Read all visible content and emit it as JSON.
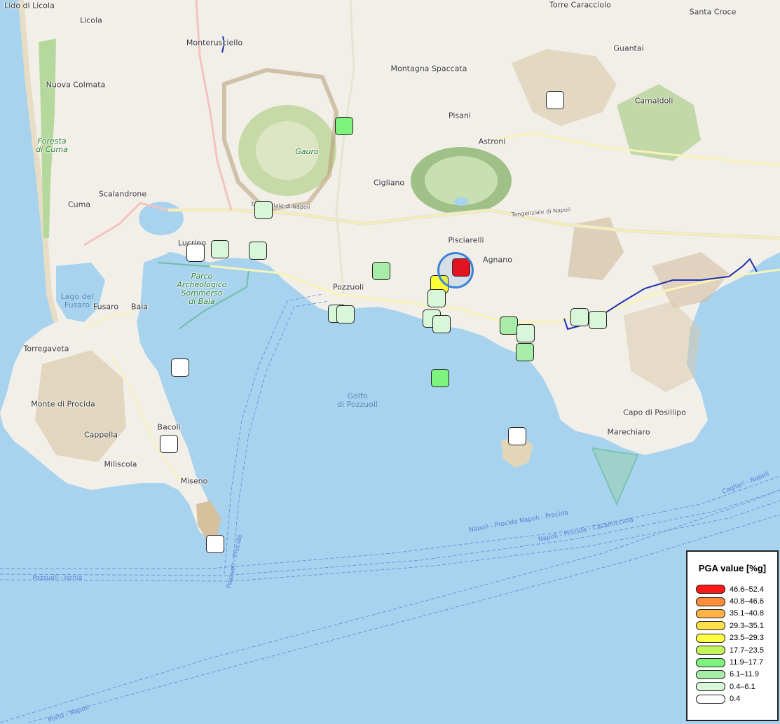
{
  "map": {
    "places": [
      {
        "id": "lido-di-licola",
        "text": "Lido di Licola",
        "type": "town"
      },
      {
        "id": "licola",
        "text": "Licola",
        "type": "town"
      },
      {
        "id": "monterusciello",
        "text": "Monterusciello",
        "type": "town"
      },
      {
        "id": "torre-caracciolo",
        "text": "Torre Caracciolo",
        "type": "town"
      },
      {
        "id": "santa-croce",
        "text": "Santa Croce",
        "type": "town"
      },
      {
        "id": "guantai",
        "text": "Guantai",
        "type": "town"
      },
      {
        "id": "nuova-colmata",
        "text": "Nuova Colmata",
        "type": "town"
      },
      {
        "id": "montagna-spaccata",
        "text": "Montagna\nSpaccata",
        "type": "town"
      },
      {
        "id": "pisani",
        "text": "Pisani",
        "type": "town"
      },
      {
        "id": "camaldoli",
        "text": "Camaldoli",
        "type": "town"
      },
      {
        "id": "astroni",
        "text": "Astroni",
        "type": "town"
      },
      {
        "id": "foresta-di-cuma",
        "text": "Foresta\ndi Cuma",
        "type": "park"
      },
      {
        "id": "gauro",
        "text": "Gauro",
        "type": "park"
      },
      {
        "id": "cigliano",
        "text": "Cigliano",
        "type": "town"
      },
      {
        "id": "scalandrone",
        "text": "Scalandrone",
        "type": "town"
      },
      {
        "id": "cuma",
        "text": "Cuma",
        "type": "town"
      },
      {
        "id": "tangenziale-napoli-1",
        "text": "Tangenziale di Napoli",
        "type": "road"
      },
      {
        "id": "tangenziale-napoli-2",
        "text": "Tangenziale di Napoli",
        "type": "road"
      },
      {
        "id": "pisciarelli",
        "text": "Pisciarelli",
        "type": "town"
      },
      {
        "id": "agnano",
        "text": "Agnano",
        "type": "town"
      },
      {
        "id": "lucrino",
        "text": "Lucrino",
        "type": "town"
      },
      {
        "id": "pozzuoli",
        "text": "Pozzuoli",
        "type": "town"
      },
      {
        "id": "lago-del-fusaro",
        "text": "Lago del\nFusaro",
        "type": "water"
      },
      {
        "id": "fusaro",
        "text": "Fusaro",
        "type": "town"
      },
      {
        "id": "baia",
        "text": "Baia",
        "type": "town"
      },
      {
        "id": "parco-archeologico",
        "text": "Parco\nArcheologico\nSommerso\ndi Baia",
        "type": "park"
      },
      {
        "id": "torregaveta",
        "text": "Torregaveta",
        "type": "town"
      },
      {
        "id": "golfo-di-pozzuoli",
        "text": "Golfo\ndi Pozzuoli",
        "type": "water"
      },
      {
        "id": "monte-di-procida",
        "text": "Monte di Procida",
        "type": "town"
      },
      {
        "id": "bacoli",
        "text": "Bacoli",
        "type": "town"
      },
      {
        "id": "cappella",
        "text": "Cappella",
        "type": "town"
      },
      {
        "id": "miliscola",
        "text": "Miliscola",
        "type": "town"
      },
      {
        "id": "miseno",
        "text": "Miseno",
        "type": "town"
      },
      {
        "id": "capo-di-posillipo",
        "text": "Capo di Posillipo",
        "type": "town"
      },
      {
        "id": "marechiaro",
        "text": "Marechiaro",
        "type": "town"
      },
      {
        "id": "napoli-procida-1",
        "text": "Napoli - Procida  Napoli - Procida",
        "type": "ferry"
      },
      {
        "id": "napoli-procida-2",
        "text": "Napoli - Procida - Casamicciola",
        "type": "ferry"
      },
      {
        "id": "pozzuoli-ischia",
        "text": "Pozzuoli - Ischia",
        "type": "ferry"
      },
      {
        "id": "pozzuoli-procida",
        "text": "Pozzuoli - Procida",
        "type": "ferry"
      },
      {
        "id": "cagliari-napoli",
        "text": "Cagliari - Napoli",
        "type": "ferry"
      },
      {
        "id": "porto-napoli",
        "text": "Porto - Napoli",
        "type": "ferry"
      }
    ],
    "stations": [
      {
        "class": "11.9–17.7",
        "color": "#7ef47e"
      },
      {
        "class": "0.4–6.1",
        "color": "#d8f7d8"
      },
      {
        "class": "0.4–6.1",
        "color": "#d8f7d8"
      },
      {
        "class": "0.4",
        "color": "#ffffff"
      },
      {
        "class": "0.4–6.1",
        "color": "#d8f7d8"
      },
      {
        "class": "0.4",
        "color": "#ffffff"
      },
      {
        "class": "6.1–11.9",
        "color": "#a7eca7"
      },
      {
        "class": "46.6–52.4",
        "color": "#ff0000"
      },
      {
        "class": "23.5–29.3",
        "color": "#ffff33"
      },
      {
        "class": "0.4–6.1",
        "color": "#d8f7d8"
      },
      {
        "class": "0.4–6.1",
        "color": "#d8f7d8"
      },
      {
        "class": "0.4–6.1",
        "color": "#d8f7d8"
      },
      {
        "class": "0.4–6.1",
        "color": "#d8f7d8"
      },
      {
        "class": "0.4–6.1",
        "color": "#d8f7d8"
      },
      {
        "class": "6.1–11.9",
        "color": "#a7eca7"
      },
      {
        "class": "0.4–6.1",
        "color": "#d8f7d8"
      },
      {
        "class": "6.1–11.9",
        "color": "#a7eca7"
      },
      {
        "class": "0.4–6.1",
        "color": "#d8f7d8"
      },
      {
        "class": "0.4–6.1",
        "color": "#d8f7d8"
      },
      {
        "class": "11.9–17.7",
        "color": "#7ef47e"
      },
      {
        "class": "0.4",
        "color": "#ffffff"
      },
      {
        "class": "0.4",
        "color": "#ffffff"
      },
      {
        "class": "0.4",
        "color": "#ffffff"
      },
      {
        "class": "0.4",
        "color": "#ffffff"
      },
      {
        "class": "6.1–11.9",
        "color": "#a7eca7"
      },
      {
        "class": "0.4–6.1",
        "color": "#d8f7d8"
      }
    ]
  },
  "legend": {
    "title": "PGA value [%g]",
    "items": [
      {
        "label": "46.6–52.4",
        "color": "#ff1a1a"
      },
      {
        "label": "40.8–46.6",
        "color": "#ff8c3a"
      },
      {
        "label": "35.1–40.8",
        "color": "#ffb347"
      },
      {
        "label": "29.3–35.1",
        "color": "#ffe04a"
      },
      {
        "label": "23.5–29.3",
        "color": "#ffff44"
      },
      {
        "label": "17.7–23.5",
        "color": "#c4f45c"
      },
      {
        "label": "11.9–17.7",
        "color": "#7ef47e"
      },
      {
        "label": "6.1–11.9",
        "color": "#a7eca7"
      },
      {
        "label": "0.4–6.1",
        "color": "#d8f7d8"
      },
      {
        "label": "0.4",
        "color": "#ffffff"
      }
    ]
  },
  "colors": {
    "sea": "#a8d3ee",
    "land": "#f2efe9",
    "park": "#c8e6b5",
    "water": "#a8d3ee",
    "epicenter": "#3a83d8"
  }
}
